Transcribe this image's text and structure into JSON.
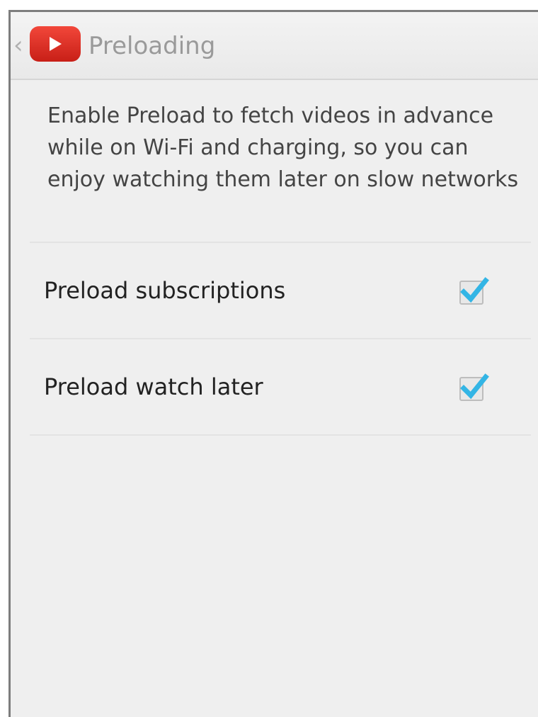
{
  "actionbar": {
    "title": "Preloading",
    "up_icon": "chevron-left-icon",
    "logo_icon": "youtube-logo-icon"
  },
  "description": "Enable Preload to fetch videos in advance while on Wi-Fi and charging, so you can enjoy watching them later on slow networks",
  "preferences": [
    {
      "label": "Preload subscriptions",
      "checked": true
    },
    {
      "label": "Preload watch later",
      "checked": true
    }
  ],
  "colors": {
    "accent": "#33b5e5",
    "logo_red": "#e62117",
    "background": "#efefef"
  }
}
